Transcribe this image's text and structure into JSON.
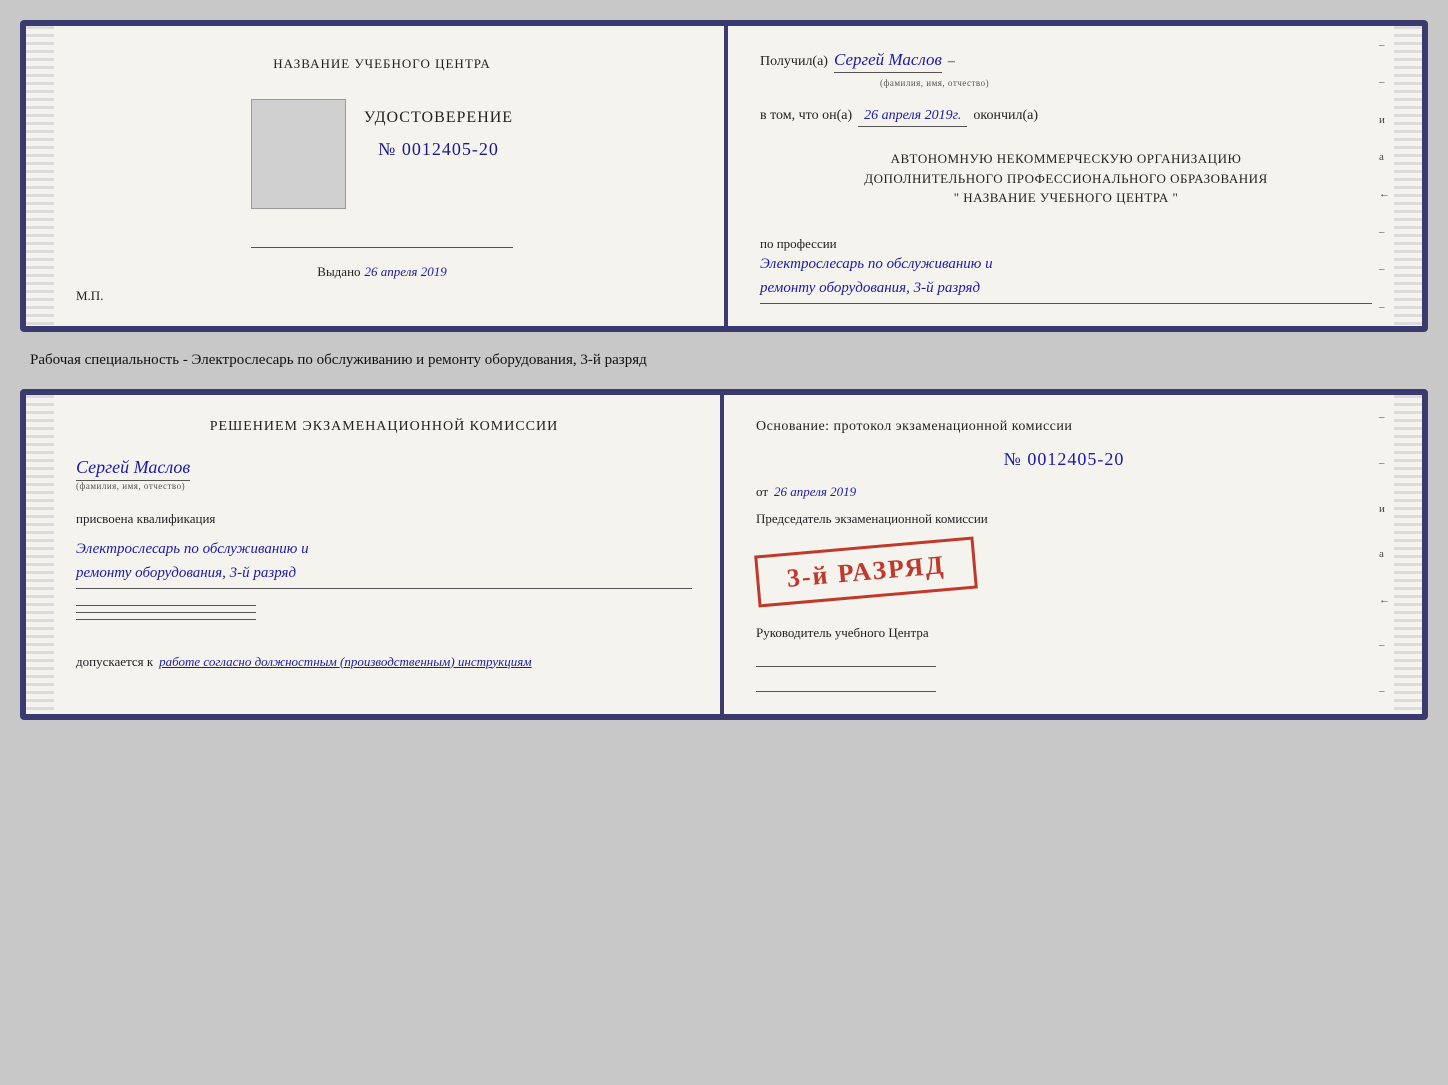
{
  "cert_top": {
    "left": {
      "school_name": "НАЗВАНИЕ УЧЕБНОГО ЦЕНТРА",
      "cert_title": "УДОСТОВЕРЕНИЕ",
      "cert_number": "№ 0012405-20",
      "issued_label": "Выдано",
      "issued_date": "26 апреля 2019",
      "mp_label": "М.П."
    },
    "right": {
      "received_prefix": "Получил(а)",
      "received_name": "Сергей Маслов",
      "fio_sub": "(фамилия, имя, отчество)",
      "dash": "–",
      "inthat_prefix": "в том, что он(а)",
      "inthat_date": "26 апреля 2019г.",
      "finished_word": "окончил(а)",
      "org_line1": "АВТОНОМНУЮ НЕКОММЕРЧЕСКУЮ ОРГАНИЗАЦИЮ",
      "org_line2": "ДОПОЛНИТЕЛЬНОГО ПРОФЕССИОНАЛЬНОГО ОБРАЗОВАНИЯ",
      "org_line3": "\" НАЗВАНИЕ УЧЕБНОГО ЦЕНТРА \"",
      "profession_label": "по профессии",
      "profession_line1": "Электрослесарь по обслуживанию и",
      "profession_line2": "ремонту оборудования, 3-й разряд"
    }
  },
  "middle": {
    "text": "Рабочая специальность - Электрослесарь по обслуживанию и ремонту оборудования, 3-й разряд"
  },
  "cert_bottom": {
    "left": {
      "decision_title": "Решением экзаменационной комиссии",
      "person_name": "Сергей Маслов",
      "fio_sub": "(фамилия, имя, отчество)",
      "qualification_label": "присвоена квалификация",
      "qualification_line1": "Электрослесарь по обслуживанию и",
      "qualification_line2": "ремонту оборудования, 3-й разряд",
      "allowed_label": "допускается к",
      "allowed_value": "работе согласно должностным (производственным) инструкциям"
    },
    "right": {
      "basis_label": "Основание: протокол экзаменационной комиссии",
      "protocol_number": "№ 0012405-20",
      "protocol_date_prefix": "от",
      "protocol_date": "26 апреля 2019",
      "chairman_label": "Председатель экзаменационной комиссии",
      "stamp_text": "3-й РАЗРЯД",
      "head_label": "Руководитель учебного Центра"
    }
  }
}
